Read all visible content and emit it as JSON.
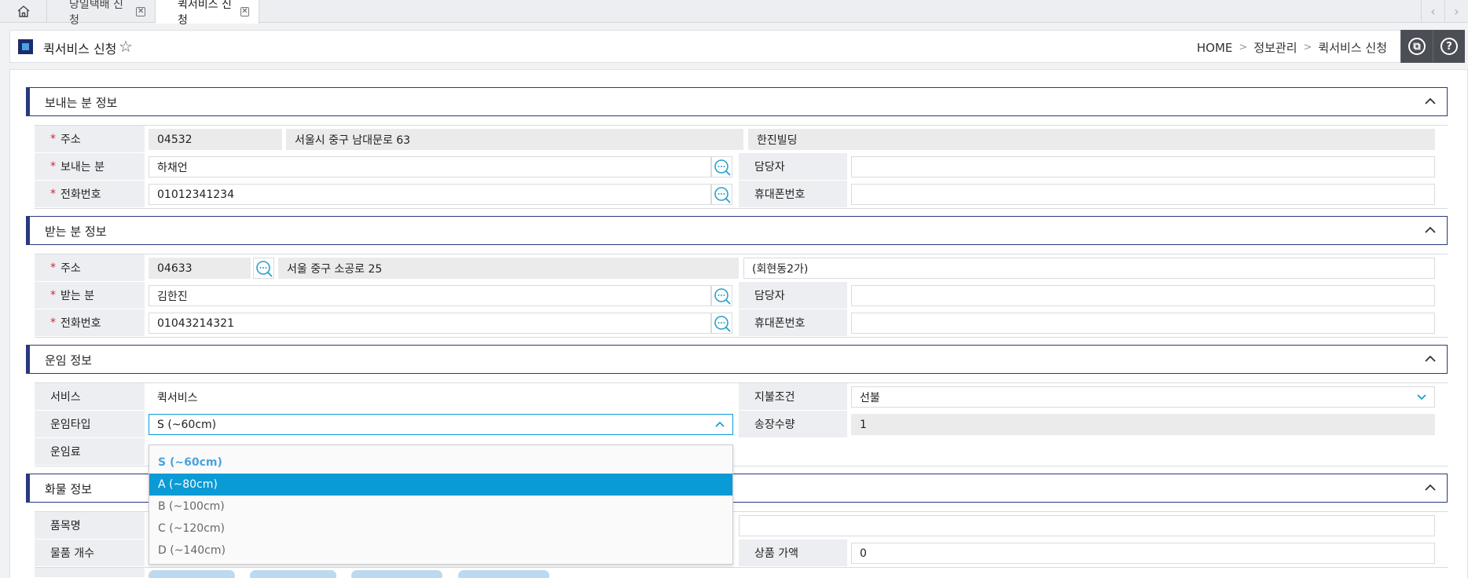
{
  "tabs": [
    {
      "label": "당일택배 신청",
      "active": false
    },
    {
      "label": "퀵서비스 신청",
      "active": true
    }
  ],
  "page": {
    "title": "퀵서비스 신청"
  },
  "breadcrumb": [
    "HOME",
    "정보관리",
    "퀵서비스 신청"
  ],
  "sender": {
    "section_title": "보내는 분 정보",
    "address_label": "주소",
    "zip": "04532",
    "address1": "서울시 중구 남대문로 63",
    "address2": "한진빌딩",
    "name_label": "보내는 분",
    "name": "하채언",
    "contact_label": "담당자",
    "contact": "",
    "phone_label": "전화번호",
    "phone": "01012341234",
    "mobile_label": "휴대폰번호",
    "mobile": ""
  },
  "receiver": {
    "section_title": "받는 분 정보",
    "address_label": "주소",
    "zip": "04633",
    "address1": "서울 중구 소공로 25",
    "address2": "(회현동2가)",
    "name_label": "받는 분",
    "name": "김한진",
    "contact_label": "담당자",
    "contact": "",
    "phone_label": "전화번호",
    "phone": "01043214321",
    "mobile_label": "휴대폰번호",
    "mobile": ""
  },
  "freight": {
    "section_title": "운임 정보",
    "service_label": "서비스",
    "service": "퀵서비스",
    "payment_label": "지불조건",
    "payment": "선불",
    "type_label": "운임타입",
    "type_value": "S (~60cm)",
    "count_label": "송장수량",
    "count": "1",
    "fee_label": "운임료",
    "options": [
      "S (~60cm)",
      "A (~80cm)",
      "B (~100cm)",
      "C (~120cm)",
      "D (~140cm)"
    ],
    "selected_option": "S (~60cm)",
    "highlighted_option": "A (~80cm)"
  },
  "cargo": {
    "section_title": "화물 정보",
    "item_label": "품목명",
    "qty_label": "물품 개수",
    "price_label": "상품 가액",
    "price": "0"
  },
  "colors": {
    "accent": "#0a9bd6",
    "navy": "#283a7d",
    "required": "#d9232b"
  }
}
